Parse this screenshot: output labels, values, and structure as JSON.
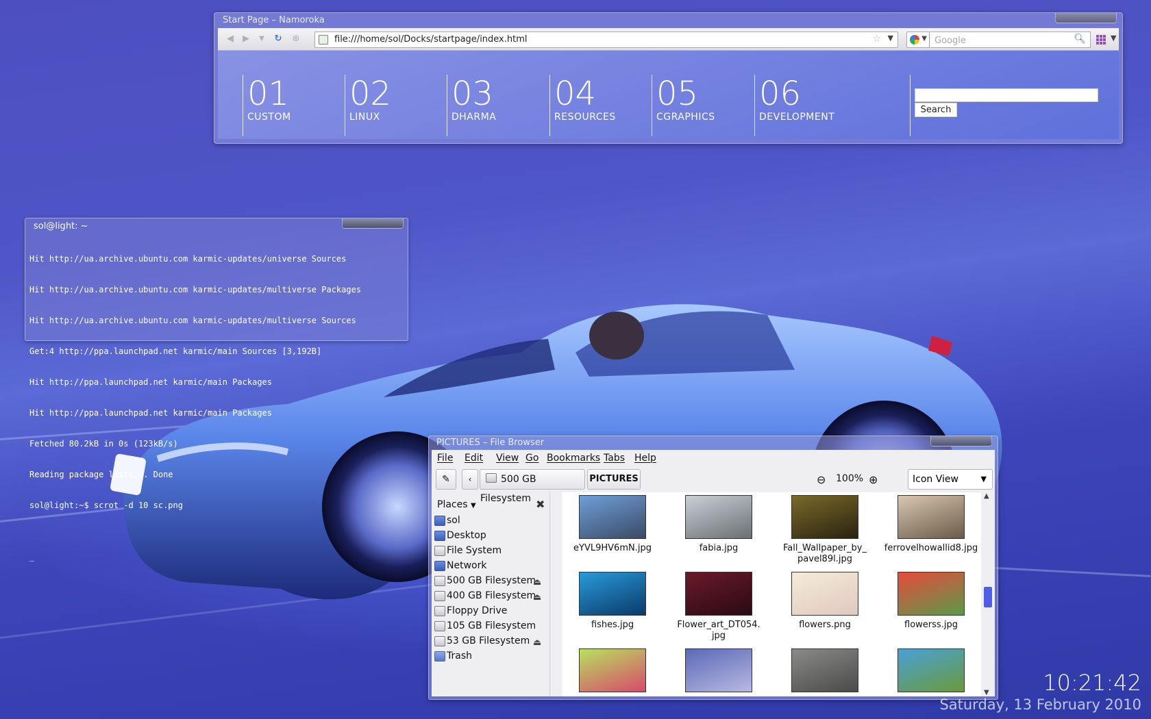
{
  "browser": {
    "title": "Start Page – Namoroka",
    "url": "file:///home/sol/Docks/startpage/index.html",
    "search_placeholder": "Google",
    "startpage": {
      "items": [
        {
          "num": "01",
          "label": "CUSTOM"
        },
        {
          "num": "02",
          "label": "LINUX"
        },
        {
          "num": "03",
          "label": "DHARMA"
        },
        {
          "num": "04",
          "label": "RESOURCES"
        },
        {
          "num": "05",
          "label": "CGRAPHICS"
        },
        {
          "num": "06",
          "label": "DEVELOPMENT"
        }
      ],
      "search_button": "Search"
    }
  },
  "terminal": {
    "title": "sol@light: ~",
    "lines": [
      "Hit http://ua.archive.ubuntu.com karmic-updates/universe Sources",
      "Hit http://ua.archive.ubuntu.com karmic-updates/multiverse Packages",
      "Hit http://ua.archive.ubuntu.com karmic-updates/multiverse Sources",
      "Get:4 http://ppa.launchpad.net karmic/main Sources [3,192B]",
      "Hit http://ppa.launchpad.net karmic/main Packages",
      "Hit http://ppa.launchpad.net karmic/main Packages",
      "Fetched 80.2kB in 0s (123kB/s)",
      "Reading package lists... Done",
      "sol@light:~$ scrot -d 10 sc.png",
      "",
      "_"
    ]
  },
  "file_browser": {
    "title": "PICTURES – File Browser",
    "menu": [
      "File",
      "Edit",
      "View",
      "Go",
      "Bookmarks",
      "Tabs",
      "Help"
    ],
    "path": {
      "device": "500 GB Filesystem",
      "current": "PICTURES"
    },
    "zoom": "100%",
    "view_mode": "Icon View",
    "places_label": "Places",
    "places": [
      {
        "label": "sol",
        "icon": "home-folder-icon",
        "eject": false
      },
      {
        "label": "Desktop",
        "icon": "desktop-icon",
        "eject": false
      },
      {
        "label": "File System",
        "icon": "drive-icon",
        "eject": false
      },
      {
        "label": "Network",
        "icon": "network-icon",
        "eject": false
      },
      {
        "label": "500 GB Filesystem",
        "icon": "drive-icon",
        "eject": true
      },
      {
        "label": "400 GB Filesystem",
        "icon": "drive-icon",
        "eject": true
      },
      {
        "label": "Floppy Drive",
        "icon": "floppy-icon",
        "eject": false
      },
      {
        "label": "105 GB Filesystem",
        "icon": "drive-icon",
        "eject": false
      },
      {
        "label": "53 GB Filesystem",
        "icon": "drive-icon",
        "eject": true
      },
      {
        "label": "Trash",
        "icon": "trash-icon",
        "eject": false
      }
    ],
    "files": [
      {
        "name": "eYVL9HV6mN.jpg",
        "colors": [
          "#6f9fd8",
          "#3b4a66"
        ]
      },
      {
        "name": "fabia.jpg",
        "colors": [
          "#c9d0d6",
          "#6a6f72"
        ]
      },
      {
        "name": "Fall_Wallpaper_by_\npavel89l.jpg",
        "colors": [
          "#7a6a2a",
          "#2a2210"
        ]
      },
      {
        "name": "ferrovelhowallid8.jpg",
        "colors": [
          "#d8c8b0",
          "#6a5a48"
        ]
      },
      {
        "name": "fishes.jpg",
        "colors": [
          "#2a9ad8",
          "#0a3a6a"
        ]
      },
      {
        "name": "Flower_art_DT054.\njpg",
        "colors": [
          "#6a1a2a",
          "#2a0a14"
        ]
      },
      {
        "name": "flowers.png",
        "colors": [
          "#f4ecd8",
          "#e0c8c0"
        ]
      },
      {
        "name": "flowerss.jpg",
        "colors": [
          "#e84a3a",
          "#5a9a4a"
        ]
      },
      {
        "name": "",
        "colors": [
          "#b8e060",
          "#d84a6a"
        ]
      },
      {
        "name": "",
        "colors": [
          "#5a6ab8",
          "#b8b8e0"
        ]
      },
      {
        "name": "",
        "colors": [
          "#8a8a88",
          "#4a4a4a"
        ]
      },
      {
        "name": "",
        "colors": [
          "#4aa0d8",
          "#6a9a3a"
        ]
      }
    ]
  },
  "clock": {
    "time": "10:21:42",
    "date": "Saturday, 13 February 2010"
  }
}
